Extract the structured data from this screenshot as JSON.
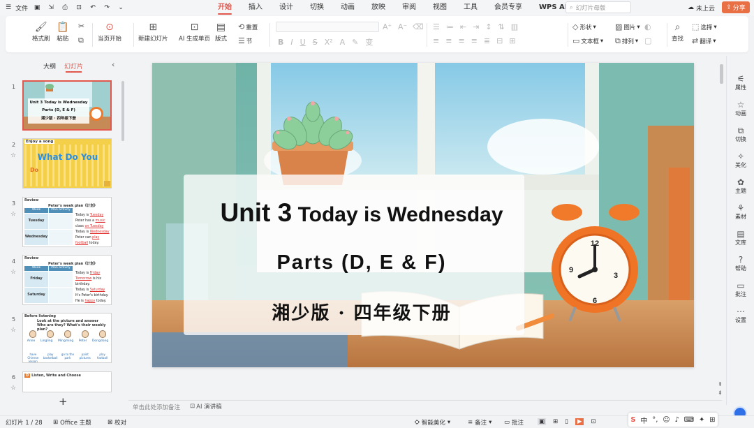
{
  "topbar": {
    "file_label": "文件",
    "tabs": [
      "开始",
      "插入",
      "设计",
      "切换",
      "动画",
      "放映",
      "审阅",
      "视图",
      "工具",
      "会员专享",
      "WPS AI"
    ],
    "active_tab": "开始",
    "search_placeholder": "幻灯片母版",
    "cloud_label": "未上云",
    "share_label": "分享"
  },
  "ribbon": {
    "format_painter": "格式刷",
    "paste": "粘贴",
    "play_from_current": "当页开始",
    "new_slide": "新建幻灯片",
    "ai_single_page": "AI 生成单页",
    "layout": "版式",
    "reset": "重置",
    "section": "节",
    "shape": "形状",
    "picture": "图片",
    "textbox": "文本框",
    "arrange": "排列",
    "find": "查找",
    "select": "选择",
    "translate": "翻译"
  },
  "left_panel": {
    "tab_outline": "大纲",
    "tab_slides": "幻灯片",
    "slide_numbers": [
      "1",
      "2",
      "3",
      "4",
      "5",
      "6"
    ],
    "thumbs": {
      "s1_title": "Unit 3 Today is Wednesday",
      "s1_sub": "Parts (D, E & F)",
      "s1_sub2": "湘少版 · 四年级下册",
      "s2_label": "Enjoy a song",
      "s2_title": "What Do You",
      "s2_sub": "Do",
      "s3_label": "Review",
      "s3_title": "Peter's week plan《计划》",
      "s3_col1": "Week",
      "s3_col2": "Plan activity",
      "s3_row1": "Tuesday",
      "s3_row2": "Wednesday",
      "s3_text1": "Today is",
      "s3_blank1": "Tuesday",
      "s3_text2": "Peter has a",
      "s3_blank2": "music",
      "s3_text3": "class",
      "s3_blank3": "on Tuesday",
      "s3_text4": "Today is",
      "s3_blank4": "Wednesday",
      "s3_text5": "Peter can",
      "s3_blank5": "play",
      "s3_blank6": "football",
      "s3_text6": "today.",
      "s4_label": "Review",
      "s4_title": "Peter's week plan《计划》",
      "s4_col1": "Week",
      "s4_col2": "Plan activity",
      "s4_row1": "Friday",
      "s4_row2": "Saturday",
      "s4_text1": "Today is",
      "s4_blank1": "Friday",
      "s4_blank2": "Tomorrow",
      "s4_text2": "is his",
      "s4_text3": "birthday.",
      "s4_text4": "Today is",
      "s4_blank3": "Saturday",
      "s4_text5": "It's Peter's birthday.",
      "s4_text6": "He is",
      "s4_blank4": "happy",
      "s4_text7": "today.",
      "s5_label": "Before listening",
      "s5_title": "Look at the picture and answer",
      "s5_q": "Who are they? What's their weekly plan?",
      "s5_names": [
        "Anne",
        "Lingling",
        "Mingming",
        "Peter",
        "Dongdong"
      ],
      "s5_acts": [
        "have Chinese lesson",
        "play basketball",
        "go to the park",
        "paint pictures",
        "play football"
      ],
      "s6_label": "Listen, Write and Choose"
    }
  },
  "slide": {
    "title_unit": "Unit 3",
    "title_rest": "Today is Wednesday",
    "subtitle": "Parts (D, E & F)",
    "edition": "湘少版 · 四年级下册"
  },
  "notes_placeholder": "单击此处添加备注",
  "ai_speech": "AI 演讲稿",
  "right_bar": [
    "属性",
    "动画",
    "切换",
    "美化",
    "主题",
    "素材",
    "文库",
    "帮助",
    "批注",
    "设置"
  ],
  "statusbar": {
    "slide_count": "幻灯片 1 / 28",
    "theme": "Office 主题",
    "proofread": "校对",
    "smart_beautify": "智能美化",
    "notes": "备注",
    "comments": "批注"
  },
  "ime": {
    "lang": "中"
  }
}
